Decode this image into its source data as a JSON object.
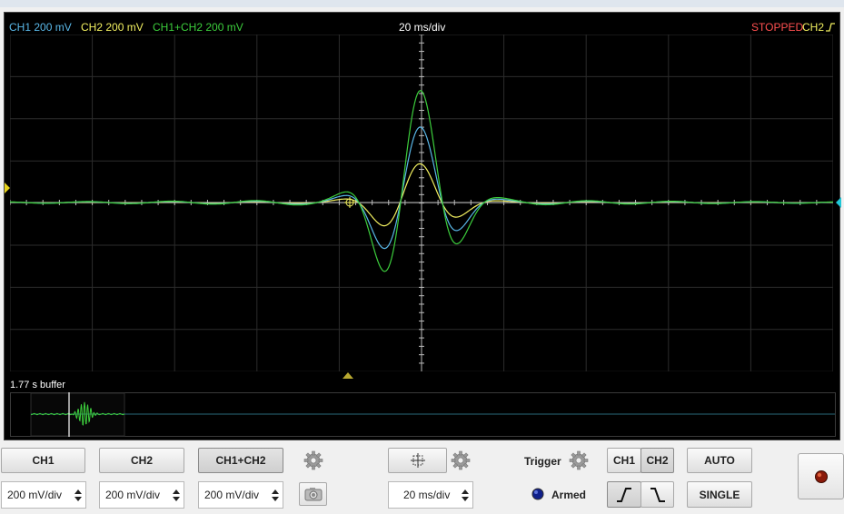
{
  "header": {
    "ch1_label": "CH1 200 mV",
    "ch2_label": "CH2 200 mV",
    "sum_label": "CH1+CH2 200 mV",
    "timebase": "20 ms/div",
    "status": "STOPPED",
    "trigger_channel": "CH2"
  },
  "colors": {
    "ch1": "#5ab8e8",
    "ch2": "#f2f060",
    "sum": "#3ccd3c",
    "stopped": "#ff5050",
    "marker_yellow": "#e6d21a",
    "marker_cyan": "#20c8d8"
  },
  "buffer": {
    "label": "1.77 s buffer"
  },
  "controls": {
    "ch1_button": "CH1",
    "ch2_button": "CH2",
    "sum_button": "CH1+CH2",
    "ch1_scale": "200 mV/div",
    "ch2_scale": "200 mV/div",
    "sum_scale": "200 mV/div",
    "time_scale": "20 ms/div",
    "trigger_label": "Trigger",
    "trig_ch1": "CH1",
    "trig_ch2": "CH2",
    "armed_label": "Armed",
    "auto_button": "AUTO",
    "single_button": "SINGLE"
  },
  "icons": {
    "gear": "gear-icon",
    "camera": "camera-icon",
    "crosshair": "crosshair-icon",
    "rising_edge": "rising-edge-icon",
    "falling_edge": "falling-edge-icon",
    "record": "record-icon"
  }
}
